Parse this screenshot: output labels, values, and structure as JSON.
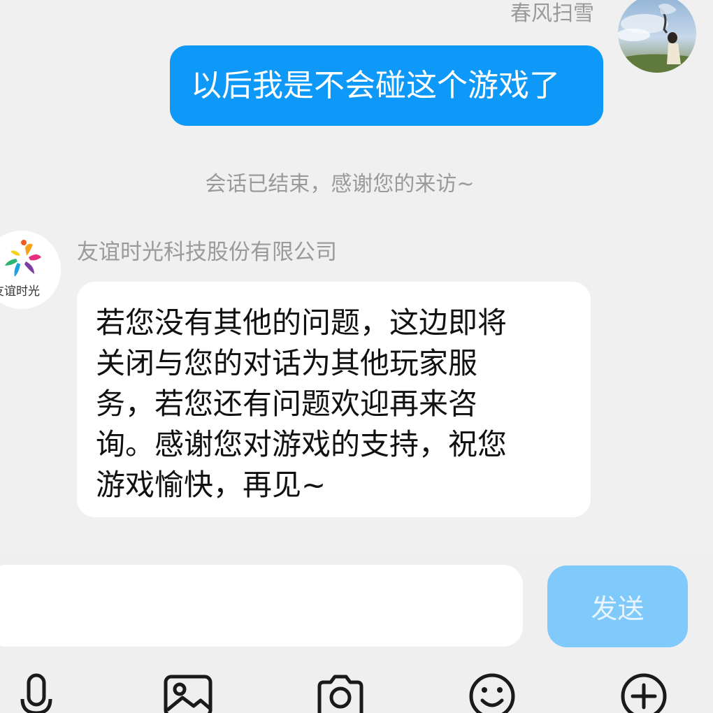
{
  "chat": {
    "outgoing": {
      "sender_name": "春风扫雪",
      "text": "以后我是不会碰这个游戏了"
    },
    "system_notice": "会话已结束，感谢您的来访~",
    "incoming": {
      "sender_name": "友谊时光科技股份有限公司",
      "avatar_label": "友谊时光",
      "lines": [
        "若您没有其他的问题，这边即将",
        "关闭与您的对话为其他玩家服",
        "务，若您还有问题欢迎再来咨",
        "询。感谢您对游戏的支持，祝您",
        "游戏愉快，再见~"
      ]
    }
  },
  "composer": {
    "input_value": "",
    "send_label": "发送"
  },
  "toolbar": {
    "icons": [
      "microphone-icon",
      "image-icon",
      "camera-icon",
      "emoji-icon",
      "plus-icon"
    ]
  },
  "colors": {
    "outgoing_bubble": "#0e98f8",
    "send_button": "#7fc9fb",
    "background": "#f0f0f0"
  }
}
